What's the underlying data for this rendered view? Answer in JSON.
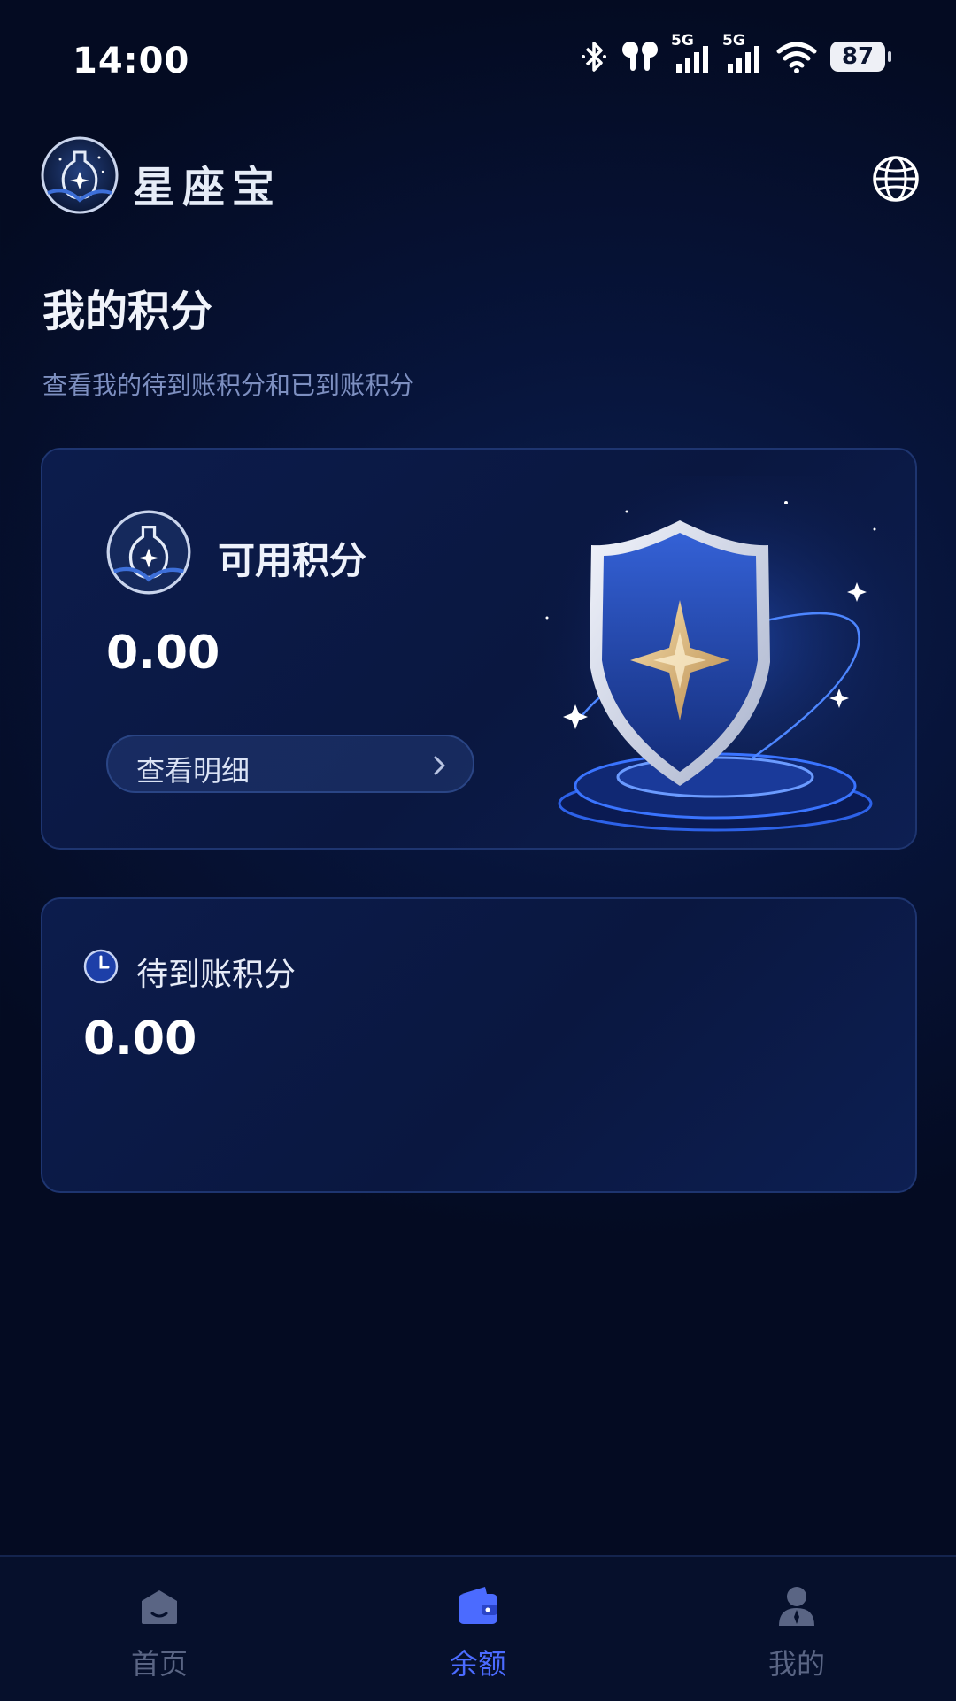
{
  "status_bar": {
    "time": "14:00",
    "network_1": "5G",
    "network_2": "5G",
    "battery": "87"
  },
  "header": {
    "brand": "星座宝",
    "logo_icon": "constellation-bottle-logo",
    "language_icon": "globe-icon"
  },
  "page": {
    "title": "我的积分",
    "subtitle": "查看我的待到账积分和已到账积分"
  },
  "available_card": {
    "label": "可用积分",
    "value": "0.00",
    "detail_button": "查看明细",
    "illustration": "shield-with-star"
  },
  "pending_card": {
    "label": "待到账积分",
    "value": "0.00",
    "icon": "clock-icon"
  },
  "tabs": [
    {
      "label": "首页",
      "icon": "home-icon",
      "active": false
    },
    {
      "label": "余额",
      "icon": "wallet-icon",
      "active": true
    },
    {
      "label": "我的",
      "icon": "user-icon",
      "active": false
    }
  ],
  "colors": {
    "accent": "#4b6bff",
    "background": "#06102c",
    "card": "#0c1c4c",
    "inactive_tab": "#5a6584",
    "subtitle": "#7d8fc0"
  }
}
